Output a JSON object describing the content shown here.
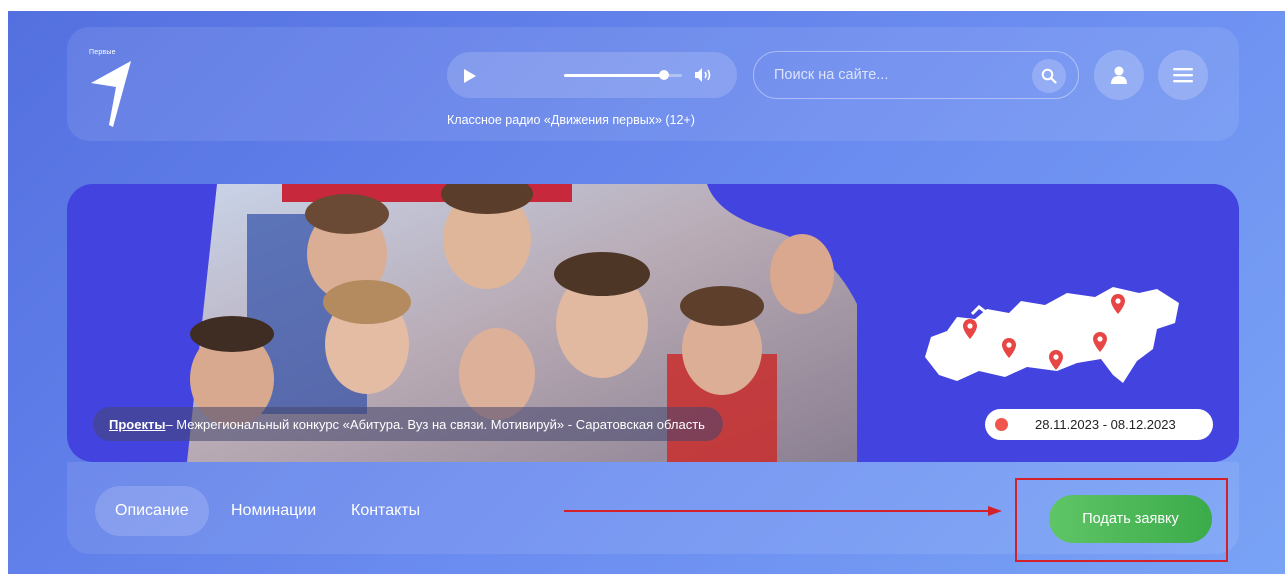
{
  "header": {
    "logo_text": "Первые",
    "radio_caption": "Классное радио «Движения первых» (12+)",
    "volume_level": 0.85,
    "search_placeholder": "Поиск на сайте..."
  },
  "banner": {
    "breadcrumb_link": "Проекты",
    "breadcrumb_text": " – Межрегиональный конкурс «Абитура. Вуз на связи. Мотивируй» - Саратовская область",
    "date_range": "28.11.2023 - 08.12.2023"
  },
  "subnav": {
    "tabs": [
      {
        "label": "Описание",
        "active": true
      },
      {
        "label": "Номинации",
        "active": false
      },
      {
        "label": "Контакты",
        "active": false
      }
    ],
    "apply_label": "Подать заявку"
  },
  "colors": {
    "accent_green": "#4cb956",
    "banner_blue": "#4343e0",
    "annotation_red": "#d3202a",
    "pin_red": "#e84545"
  }
}
